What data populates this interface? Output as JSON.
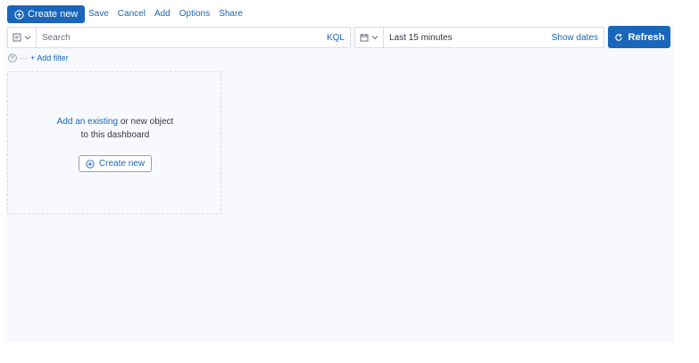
{
  "topbar": {
    "create_new_label": "Create new",
    "menu": [
      {
        "label": "Save"
      },
      {
        "label": "Cancel"
      },
      {
        "label": "Add"
      },
      {
        "label": "Options"
      },
      {
        "label": "Share"
      }
    ]
  },
  "search": {
    "placeholder": "Search",
    "language_label": "KQL"
  },
  "time": {
    "value": "Last 15 minutes",
    "show_dates_label": "Show dates"
  },
  "refresh_label": "Refresh",
  "filter": {
    "add_label": "+ Add filter"
  },
  "empty_panel": {
    "link_text": "Add an existing",
    "line1_rest": " or new object",
    "line2": "to this dashboard",
    "button_label": "Create new"
  },
  "colors": {
    "primary": "#1a66ba",
    "page_bg": "#f7f9fc"
  }
}
